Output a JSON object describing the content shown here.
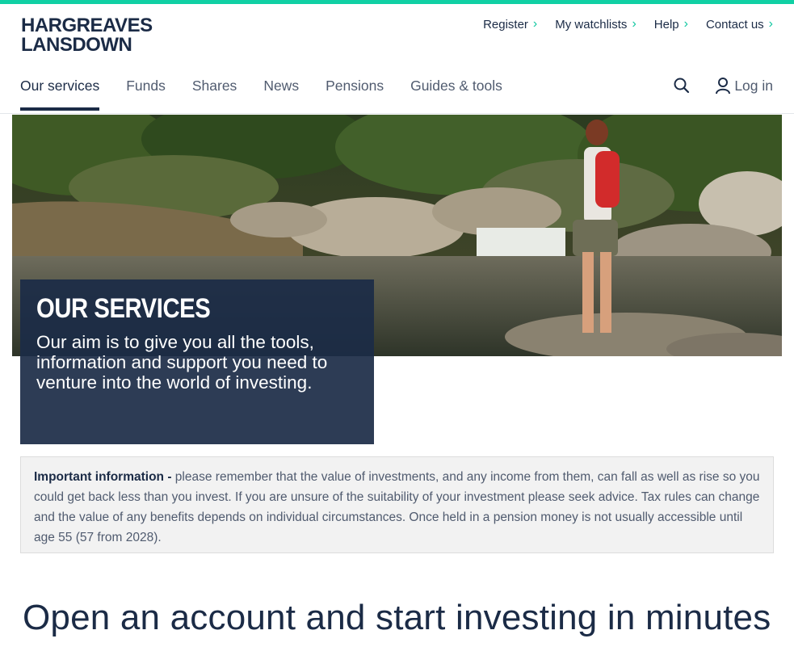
{
  "brand": {
    "line1": "HARGREAVES",
    "line2": "LANSDOWN"
  },
  "utility_nav": [
    {
      "label": "Register"
    },
    {
      "label": "My watchlists"
    },
    {
      "label": "Help"
    },
    {
      "label": "Contact us"
    }
  ],
  "main_nav": {
    "items": [
      {
        "label": "Our services",
        "active": true
      },
      {
        "label": "Funds"
      },
      {
        "label": "Shares"
      },
      {
        "label": "News"
      },
      {
        "label": "Pensions"
      },
      {
        "label": "Guides & tools"
      }
    ],
    "login_label": "Log in"
  },
  "hero": {
    "title": "OUR SERVICES",
    "subtitle": "Our aim is to give you all the tools, information and support you need to venture into the world of investing."
  },
  "important_info": {
    "label": "Important information -",
    "text": " please remember that the value of investments, and any income from them, can fall as well as rise so you could get back less than you invest. If you are unsure of the suitability of your investment please seek advice. Tax rules can change and the value of any benefits depends on individual circumstances. Once held in a pension money is not usually accessible until age 55 (57 from 2028)."
  },
  "cta": {
    "heading": "Open an account and start investing in minutes"
  },
  "colors": {
    "navy": "#1b2b46",
    "accent": "#10d0a4"
  }
}
